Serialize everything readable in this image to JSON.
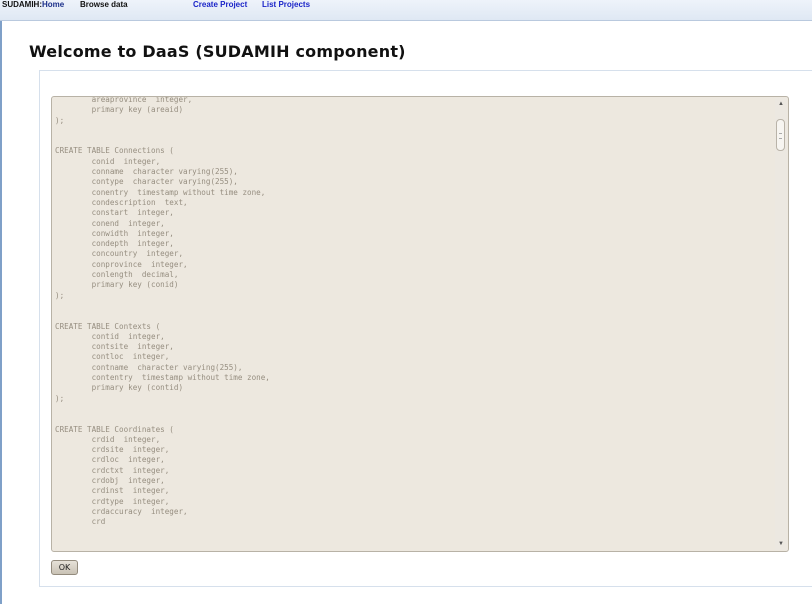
{
  "nav": {
    "brand": "SUDAMIH:",
    "home": "Home",
    "browse": "Browse data",
    "create": "Create Project",
    "list": "List Projects"
  },
  "page": {
    "title": "Welcome to DaaS (SUDAMIH component)"
  },
  "editor": {
    "content": "        areaprovince  integer,\n        primary key (areaid)\n);\n\n\nCREATE TABLE Connections (\n        conid  integer,\n        conname  character varying(255),\n        contype  character varying(255),\n        conentry  timestamp without time zone,\n        condescription  text,\n        constart  integer,\n        conend  integer,\n        conwidth  integer,\n        condepth  integer,\n        concountry  integer,\n        conprovince  integer,\n        conlength  decimal,\n        primary key (conid)\n);\n\n\nCREATE TABLE Contexts (\n        contid  integer,\n        contsite  integer,\n        contloc  integer,\n        contname  character varying(255),\n        contentry  timestamp without time zone,\n        primary key (contid)\n);\n\n\nCREATE TABLE Coordinates (\n        crdid  integer,\n        crdsite  integer,\n        crdloc  integer,\n        crdctxt  integer,\n        crdobj  integer,\n        crdinst  integer,\n        crdtype  integer,\n        crdaccuracy  integer,\n        crd"
  },
  "actions": {
    "ok": "OK"
  },
  "colors": {
    "nav_link": "#1a24c8",
    "editor_bg": "#ede8df",
    "code_text": "#968e80"
  }
}
